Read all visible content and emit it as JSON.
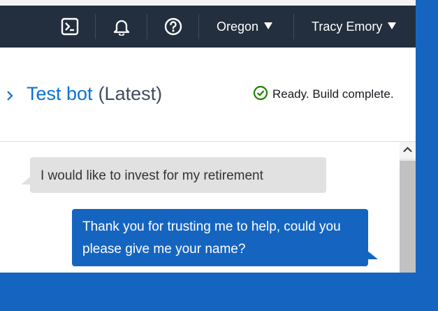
{
  "navbar": {
    "region_label": "Oregon",
    "user_label": "Tracy Emory"
  },
  "header": {
    "title": "Test bot",
    "title_suffix": "(Latest)",
    "status_text": "Ready. Build complete."
  },
  "chat": {
    "messages": [
      {
        "sender": "user",
        "text": "I would like to invest for my retirement"
      },
      {
        "sender": "bot",
        "text": "Thank you for trusting me to help, could you please give me your name?"
      }
    ]
  },
  "colors": {
    "navbar_bg": "#232f3e",
    "title_link": "#0972d3",
    "status_success": "#1d8102",
    "user_bubble": "#e1e1e1",
    "bot_bubble": "#1565c0",
    "page_bg": "#1565c0"
  },
  "icons": {
    "cloudshell": "terminal-icon",
    "notifications": "bell-icon",
    "help": "help-icon",
    "status": "check-circle-icon",
    "expand": "chevron-right-icon"
  }
}
